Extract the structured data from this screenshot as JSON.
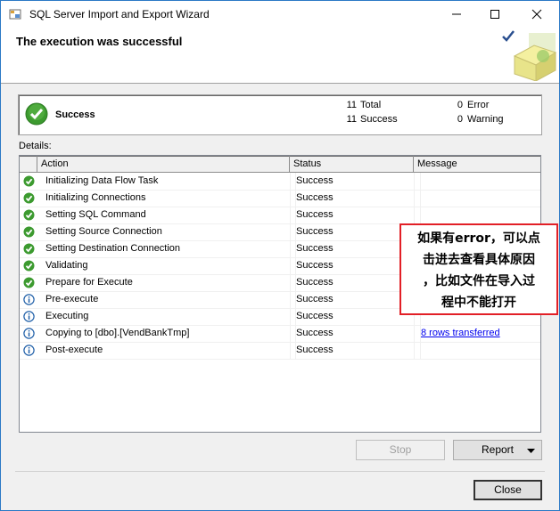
{
  "window": {
    "title": "SQL Server Import and Export Wizard"
  },
  "header": {
    "title": "The execution was successful"
  },
  "summary": {
    "status": "Success",
    "total_count": "11",
    "total_label": "Total",
    "success_count": "11",
    "success_label": "Success",
    "error_count": "0",
    "error_label": "Error",
    "warning_count": "0",
    "warning_label": "Warning"
  },
  "details": {
    "label": "Details:",
    "columns": [
      "Action",
      "Status",
      "Message"
    ],
    "rows": [
      {
        "icon": "success-check-icon",
        "action": "Initializing Data Flow Task",
        "status": "Success",
        "message": ""
      },
      {
        "icon": "success-check-icon",
        "action": "Initializing Connections",
        "status": "Success",
        "message": ""
      },
      {
        "icon": "success-check-icon",
        "action": "Setting SQL Command",
        "status": "Success",
        "message": ""
      },
      {
        "icon": "success-check-icon",
        "action": "Setting Source Connection",
        "status": "Success",
        "message": ""
      },
      {
        "icon": "success-check-icon",
        "action": "Setting Destination Connection",
        "status": "Success",
        "message": ""
      },
      {
        "icon": "success-check-icon",
        "action": "Validating",
        "status": "Success",
        "message": ""
      },
      {
        "icon": "success-check-icon",
        "action": "Prepare for Execute",
        "status": "Success",
        "message": ""
      },
      {
        "icon": "info-icon",
        "action": "Pre-execute",
        "status": "Success",
        "message": ""
      },
      {
        "icon": "info-icon",
        "action": "Executing",
        "status": "Success",
        "message": ""
      },
      {
        "icon": "info-icon",
        "action": "Copying to [dbo].[VendBankTmp]",
        "status": "Success",
        "message": "8 rows transferred"
      },
      {
        "icon": "info-icon",
        "action": "Post-execute",
        "status": "Success",
        "message": ""
      }
    ]
  },
  "buttons": {
    "stop": "Stop",
    "report": "Report",
    "close": "Close"
  },
  "annotation": {
    "lines": [
      "如果有error，可以点",
      "击进去查看具体原因",
      "，比如文件在导入过",
      "程中不能打开"
    ]
  },
  "colors": {
    "success_green": "#3c9a2f",
    "info_blue": "#1f5fa8",
    "annotation_border": "#e21f26",
    "link": "#0000ee"
  }
}
